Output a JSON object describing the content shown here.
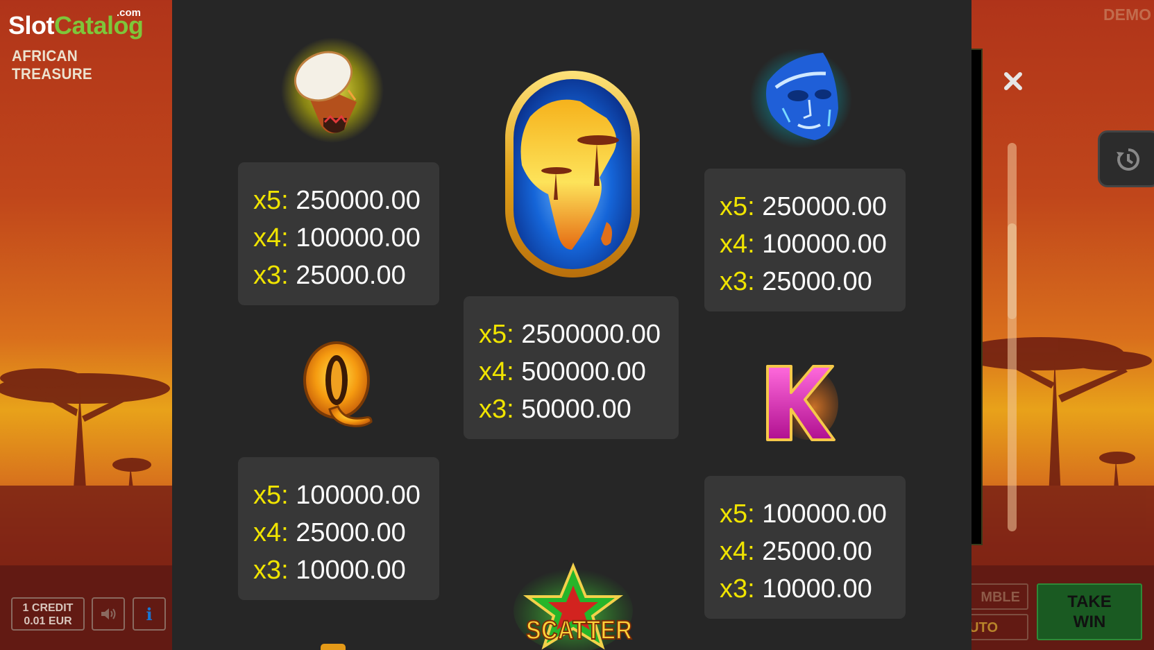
{
  "brand": {
    "logo_slot": "Slot",
    "logo_catalog": "Catalog",
    "logo_com": ".com",
    "game_name": "AFRICAN TREASURE"
  },
  "demo_label": "DEMO",
  "bottom_bar": {
    "credit_line1": "1 CREDIT",
    "credit_line2": "0.01 EUR",
    "gamble_label": "MBLE",
    "auto_label": "UTO",
    "take_win_line1": "TAKE",
    "take_win_line2": "WIN"
  },
  "icons": {
    "close": "close-icon",
    "history": "history-icon",
    "sound": "speaker-icon",
    "info": "info-icon"
  },
  "colors": {
    "multiplier": "#f0e400",
    "panel_bg": "#262626",
    "pay_box_bg": "#373737",
    "take_win_bg": "#1a5a22"
  },
  "paytable": [
    {
      "symbol": "drum-icon",
      "payouts": [
        {
          "mult": "x5:",
          "value": "250000.00"
        },
        {
          "mult": "x4:",
          "value": "100000.00"
        },
        {
          "mult": "x3:",
          "value": "25000.00"
        }
      ]
    },
    {
      "symbol": "africa-map-icon",
      "payouts": [
        {
          "mult": "x5:",
          "value": "2500000.00"
        },
        {
          "mult": "x4:",
          "value": "500000.00"
        },
        {
          "mult": "x3:",
          "value": "50000.00"
        }
      ]
    },
    {
      "symbol": "blue-mask-icon",
      "payouts": [
        {
          "mult": "x5:",
          "value": "250000.00"
        },
        {
          "mult": "x4:",
          "value": "100000.00"
        },
        {
          "mult": "x3:",
          "value": "25000.00"
        }
      ]
    },
    {
      "symbol": "letter-q-icon",
      "symbol_text": "Q",
      "payouts": [
        {
          "mult": "x5:",
          "value": "100000.00"
        },
        {
          "mult": "x4:",
          "value": "25000.00"
        },
        {
          "mult": "x3:",
          "value": "10000.00"
        }
      ]
    },
    {
      "symbol": "letter-k-icon",
      "symbol_text": "K",
      "payouts": [
        {
          "mult": "x5:",
          "value": "100000.00"
        },
        {
          "mult": "x4:",
          "value": "25000.00"
        },
        {
          "mult": "x3:",
          "value": "10000.00"
        }
      ]
    }
  ],
  "scatter": {
    "symbol": "scatter-star-icon",
    "label": "SCATTER"
  }
}
